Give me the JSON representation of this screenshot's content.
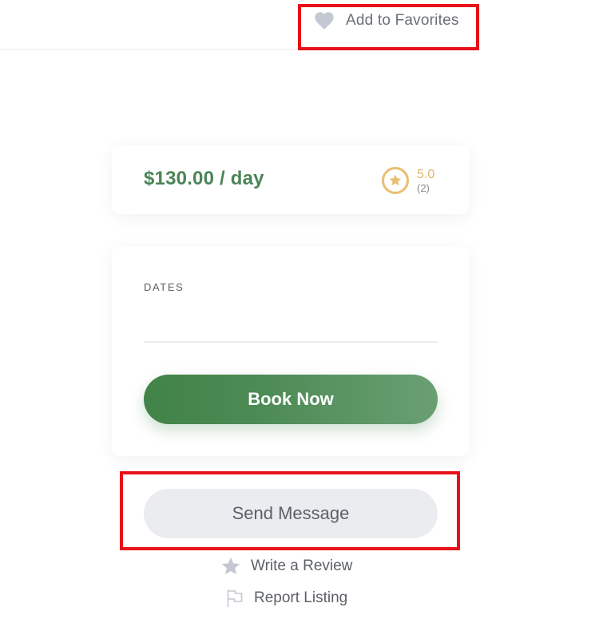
{
  "header": {
    "favorites_label": "Add to Favorites"
  },
  "price_card": {
    "price": "$130.00 / day",
    "rating_score": "5.0",
    "rating_count": "(2)"
  },
  "booking": {
    "dates_label": "DATES",
    "dates_value": "",
    "book_label": "Book Now"
  },
  "actions": {
    "send_message_label": "Send Message",
    "write_review_label": "Write a Review",
    "report_listing_label": "Report Listing"
  },
  "colors": {
    "accent_green": "#4a8456",
    "rating_gold": "#e2b56a",
    "highlight_red": "#e8111a",
    "muted_text": "#5d6068"
  },
  "icons": {
    "favorites": "heart-icon",
    "rating": "star-circle-icon",
    "review": "star-icon",
    "report": "flag-icon"
  }
}
